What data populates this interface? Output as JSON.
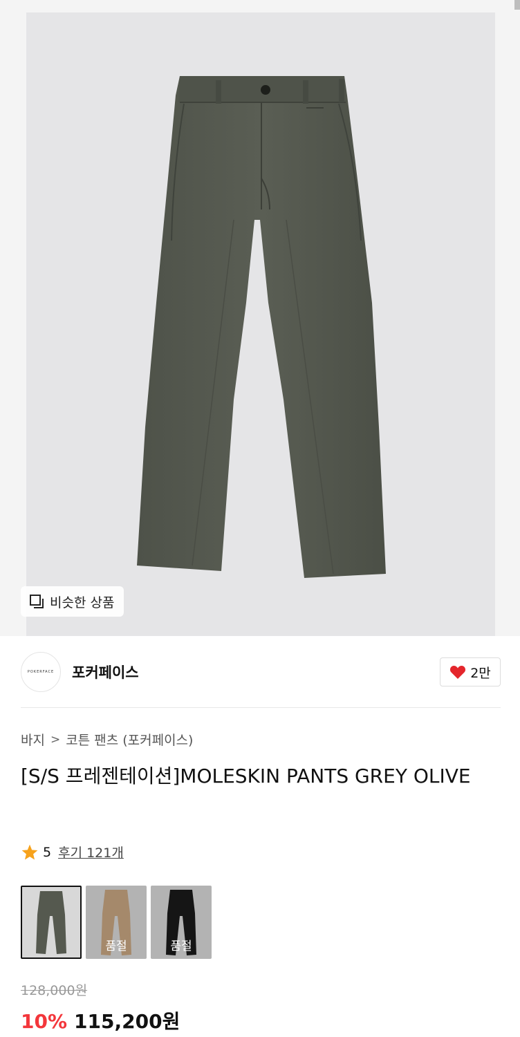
{
  "hero": {
    "similar_label": "비슷한 상품",
    "icon": "similar-items-icon"
  },
  "brand": {
    "logo_text": "POKERFACE",
    "name": "포커페이스",
    "like_count": "2만",
    "like_icon": "heart-icon"
  },
  "breadcrumb": {
    "items": [
      "바지",
      "코튼 팬츠 (포커페이스)"
    ],
    "separator": ">"
  },
  "product": {
    "title": "[S/S 프레젠테이션]MOLESKIN PANTS GREY OLIVE"
  },
  "rating": {
    "score": "5",
    "reviews_label": "후기 121개"
  },
  "variants": [
    {
      "color": "grey olive",
      "status": "",
      "selected": true
    },
    {
      "color": "beige",
      "status": "품절",
      "selected": false
    },
    {
      "color": "black",
      "status": "품절",
      "selected": false
    }
  ],
  "price": {
    "original": "128,000원",
    "discount": "10%",
    "sale": "115,200원"
  },
  "colors": {
    "accent_red": "#f3363b",
    "pants_olive": "#55594f",
    "heart": "#e4262c",
    "star": "#f7a21b"
  }
}
